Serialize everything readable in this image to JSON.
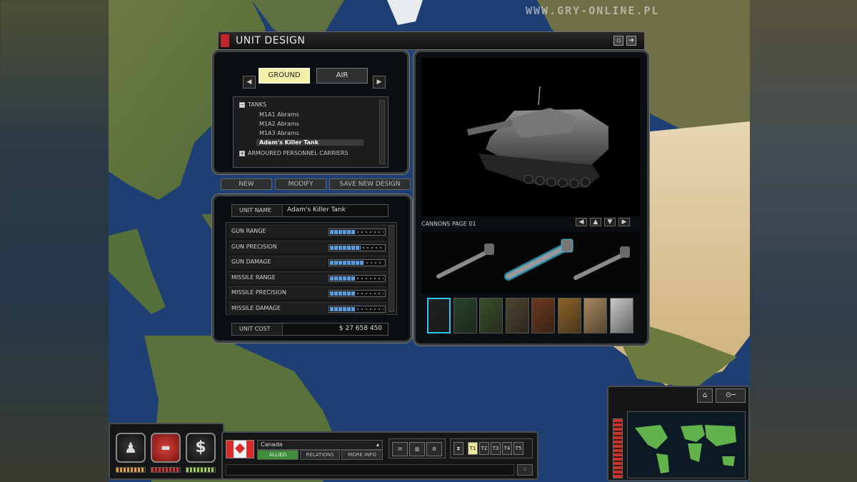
{
  "watermark": "WWW.GRY-ONLINE.PL",
  "window": {
    "title": "UNIT DESIGN",
    "minimize_icon": "minimize-icon",
    "close_icon": "close-icon"
  },
  "category_tabs": {
    "ground": "GROUND",
    "air": "AIR",
    "active": "GROUND"
  },
  "tree": {
    "items": [
      {
        "label": "TANKS",
        "expander": "−"
      },
      {
        "label": "M1A1 Abrams"
      },
      {
        "label": "M1A2 Abrams"
      },
      {
        "label": "M1A3 Abrams"
      },
      {
        "label": "Adam's Killer Tank",
        "selected": true
      },
      {
        "label": "ARMOURED PERSONNEL CARRIERS",
        "expander": "+"
      }
    ]
  },
  "actions": {
    "new": "NEW",
    "modify": "MODIFY",
    "save": "SAVE NEW DESIGN"
  },
  "unit": {
    "name_label": "UNIT NAME",
    "name_value": "Adam's Killer Tank",
    "cost_label": "UNIT COST",
    "cost_value": "$ 27 658 450"
  },
  "stats": [
    {
      "label": "GUN RANGE",
      "level": 0.45
    },
    {
      "label": "GUN PRECISION",
      "level": 0.55
    },
    {
      "label": "GUN DAMAGE",
      "level": 0.62
    },
    {
      "label": "MISSILE RANGE",
      "level": 0.45
    },
    {
      "label": "MISSILE PRECISION",
      "level": 0.45
    },
    {
      "label": "MISSILE DAMAGE",
      "level": 0.45
    }
  ],
  "cannons": {
    "label": "CANNONS PAGE 01",
    "selected_index": 1
  },
  "swatches": [
    "#1f2224",
    "#29442c",
    "#3c4f2a",
    "#4f4432",
    "#6b3a1e",
    "#8d6429",
    "#a8875c",
    "#c9c9c9"
  ],
  "hud": {
    "country_name": "Canada",
    "status": "ALLIED",
    "relations": "RELATIONS",
    "more_info": "MORE INFO",
    "speed_buttons": [
      "T1",
      "T2",
      "T3",
      "T4",
      "T5"
    ],
    "accent": "#3f8f3a"
  }
}
